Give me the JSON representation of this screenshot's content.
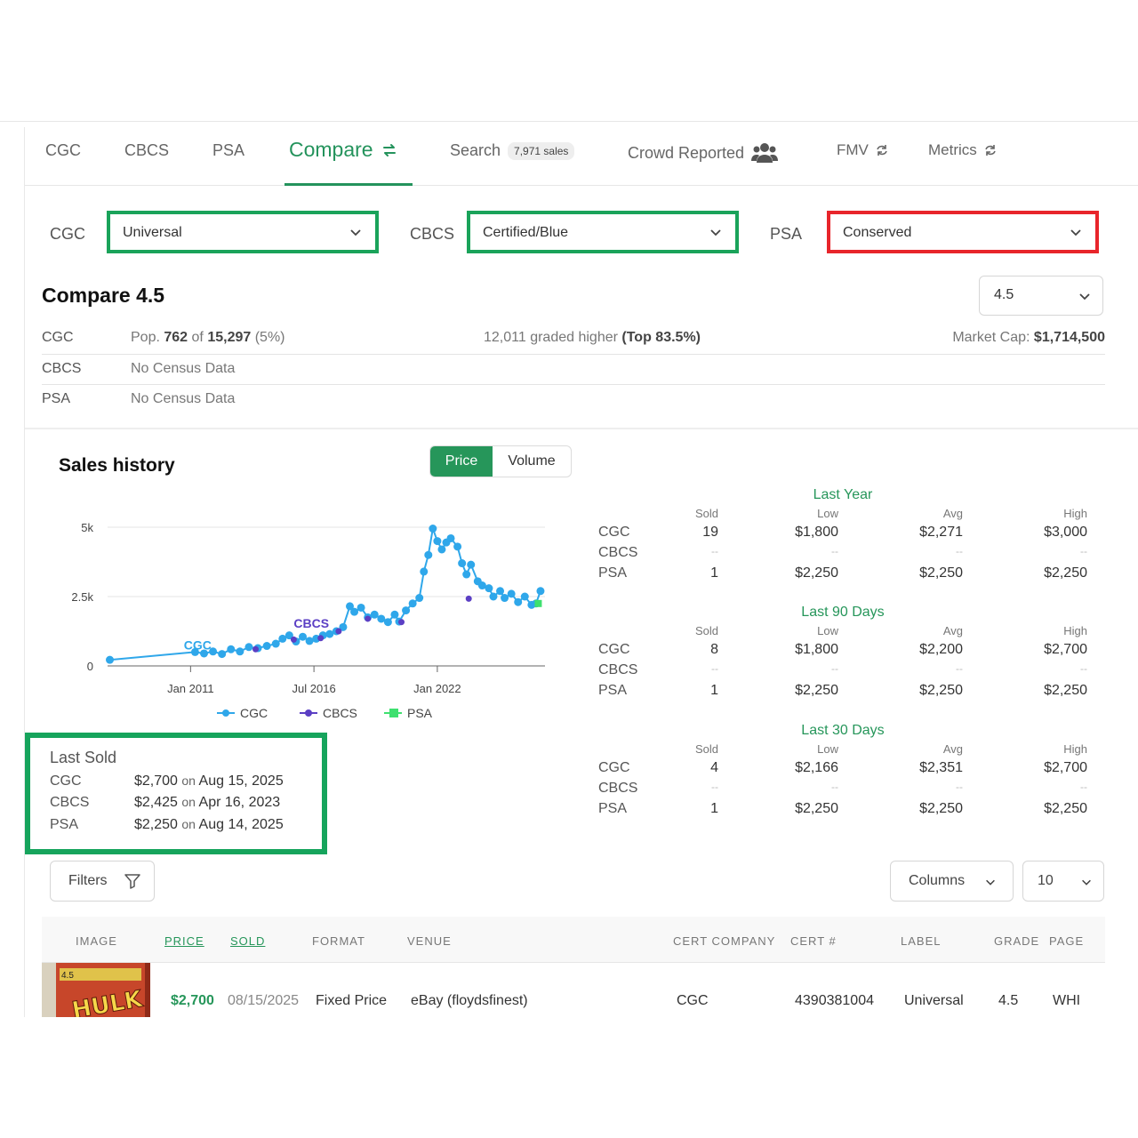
{
  "tabs": [
    {
      "label": "CGC"
    },
    {
      "label": "CBCS"
    },
    {
      "label": "PSA"
    },
    {
      "label": "Compare"
    },
    {
      "label": "Search",
      "badge": "7,971 sales"
    },
    {
      "label": "Crowd Reported"
    },
    {
      "label": "FMV"
    },
    {
      "label": "Metrics"
    }
  ],
  "filters": {
    "cgc_label": "CGC",
    "cgc_value": "Universal",
    "cbcs_label": "CBCS",
    "cbcs_value": "Certified/Blue",
    "psa_label": "PSA",
    "psa_value": "Conserved"
  },
  "compare": {
    "title": "Compare 4.5",
    "grade": "4.5",
    "rows": [
      {
        "company": "CGC",
        "pop_prefix": "Pop.",
        "pop_count": "762",
        "pop_of": "of",
        "pop_total": "15,297",
        "pop_pct": "(5%)",
        "higher": "12,011 graded higher",
        "higher_top": "(Top 83.5%)",
        "mcap_label": "Market Cap:",
        "mcap": "$1,714,500"
      },
      {
        "company": "CBCS",
        "census": "No Census Data"
      },
      {
        "company": "PSA",
        "census": "No Census Data"
      }
    ]
  },
  "sales_history": {
    "title": "Sales history",
    "toggle_price": "Price",
    "toggle_volume": "Volume"
  },
  "chart_data": {
    "type": "scatter",
    "yticks": [
      "0",
      "2.5k",
      "5k"
    ],
    "ylim": [
      0,
      5000
    ],
    "xticks": [
      "Jan 2011",
      "Jul 2016",
      "Jan 2022"
    ],
    "annotations": [
      "CGC",
      "CBCS"
    ],
    "legend": [
      "CGC",
      "CBCS",
      "PSA"
    ],
    "series": [
      {
        "name": "CGC",
        "color": "#2fa7ea",
        "points": [
          [
            2007.4,
            220
          ],
          [
            2011.2,
            500
          ],
          [
            2011.6,
            450
          ],
          [
            2012.0,
            520
          ],
          [
            2012.4,
            430
          ],
          [
            2012.8,
            600
          ],
          [
            2013.2,
            520
          ],
          [
            2013.6,
            680
          ],
          [
            2014.0,
            640
          ],
          [
            2014.4,
            720
          ],
          [
            2014.8,
            800
          ],
          [
            2015.1,
            980
          ],
          [
            2015.4,
            1100
          ],
          [
            2015.7,
            880
          ],
          [
            2016.0,
            1050
          ],
          [
            2016.3,
            900
          ],
          [
            2016.6,
            980
          ],
          [
            2016.9,
            1100
          ],
          [
            2017.2,
            1150
          ],
          [
            2017.5,
            1250
          ],
          [
            2017.8,
            1400
          ],
          [
            2018.1,
            2150
          ],
          [
            2018.3,
            1950
          ],
          [
            2018.6,
            2100
          ],
          [
            2018.9,
            1750
          ],
          [
            2019.2,
            1850
          ],
          [
            2019.5,
            1700
          ],
          [
            2019.8,
            1580
          ],
          [
            2020.1,
            1850
          ],
          [
            2020.3,
            1600
          ],
          [
            2020.6,
            2000
          ],
          [
            2020.9,
            2250
          ],
          [
            2021.2,
            2450
          ],
          [
            2021.4,
            3400
          ],
          [
            2021.6,
            4000
          ],
          [
            2021.8,
            4950
          ],
          [
            2022.0,
            4500
          ],
          [
            2022.2,
            4200
          ],
          [
            2022.4,
            4450
          ],
          [
            2022.6,
            4600
          ],
          [
            2022.9,
            4300
          ],
          [
            2023.1,
            3700
          ],
          [
            2023.3,
            3300
          ],
          [
            2023.5,
            3650
          ],
          [
            2023.8,
            3050
          ],
          [
            2024.0,
            2900
          ],
          [
            2024.3,
            2800
          ],
          [
            2024.5,
            2500
          ],
          [
            2024.8,
            2700
          ],
          [
            2025.0,
            2450
          ],
          [
            2025.3,
            2600
          ],
          [
            2025.6,
            2300
          ],
          [
            2025.9,
            2500
          ],
          [
            2026.2,
            2200
          ],
          [
            2026.4,
            2250
          ],
          [
            2026.6,
            2700
          ]
        ]
      },
      {
        "name": "CBCS",
        "color": "#5b3fc4",
        "points": [
          [
            2013.9,
            600
          ],
          [
            2015.6,
            950
          ],
          [
            2016.8,
            1000
          ],
          [
            2017.6,
            1250
          ],
          [
            2018.9,
            1700
          ],
          [
            2020.4,
            1580
          ],
          [
            2023.4,
            2425
          ]
        ]
      },
      {
        "name": "PSA",
        "color": "#3ee06f",
        "points": [
          [
            2026.5,
            2250
          ]
        ]
      }
    ]
  },
  "last_sold": {
    "title": "Last Sold",
    "rows": [
      {
        "company": "CGC",
        "price": "$2,700",
        "on": "on",
        "date": "Aug 15, 2025"
      },
      {
        "company": "CBCS",
        "price": "$2,425",
        "on": "on",
        "date": "Apr 16, 2023"
      },
      {
        "company": "PSA",
        "price": "$2,250",
        "on": "on",
        "date": "Aug 14, 2025"
      }
    ]
  },
  "stats": {
    "headers": {
      "sold": "Sold",
      "low": "Low",
      "avg": "Avg",
      "high": "High"
    },
    "blocks": [
      {
        "title": "Last Year",
        "rows": [
          {
            "company": "CGC",
            "sold": "19",
            "low": "$1,800",
            "avg": "$2,271",
            "high": "$3,000"
          },
          {
            "company": "CBCS",
            "sold": "--",
            "low": "--",
            "avg": "--",
            "high": "--"
          },
          {
            "company": "PSA",
            "sold": "1",
            "low": "$2,250",
            "avg": "$2,250",
            "high": "$2,250"
          }
        ]
      },
      {
        "title": "Last 90 Days",
        "rows": [
          {
            "company": "CGC",
            "sold": "8",
            "low": "$1,800",
            "avg": "$2,200",
            "high": "$2,700"
          },
          {
            "company": "CBCS",
            "sold": "--",
            "low": "--",
            "avg": "--",
            "high": "--"
          },
          {
            "company": "PSA",
            "sold": "1",
            "low": "$2,250",
            "avg": "$2,250",
            "high": "$2,250"
          }
        ]
      },
      {
        "title": "Last 30 Days",
        "rows": [
          {
            "company": "CGC",
            "sold": "4",
            "low": "$2,166",
            "avg": "$2,351",
            "high": "$2,700"
          },
          {
            "company": "CBCS",
            "sold": "--",
            "low": "--",
            "avg": "--",
            "high": "--"
          },
          {
            "company": "PSA",
            "sold": "1",
            "low": "$2,250",
            "avg": "$2,250",
            "high": "$2,250"
          }
        ]
      }
    ]
  },
  "table_controls": {
    "filters": "Filters",
    "columns": "Columns",
    "page_size": "10"
  },
  "table": {
    "headers": [
      "IMAGE",
      "PRICE",
      "SOLD",
      "FORMAT",
      "VENUE",
      "CERT COMPANY",
      "CERT #",
      "LABEL",
      "GRADE",
      "PAGE"
    ],
    "rows": [
      {
        "image_text": "HULK",
        "image_grade": "4.5",
        "price": "$2,700",
        "sold": "08/15/2025",
        "format": "Fixed Price",
        "venue": "eBay (floydsfinest)",
        "cert_company": "CGC",
        "cert_no": "4390381004",
        "label": "Universal",
        "grade": "4.5",
        "page": "WHI"
      }
    ]
  },
  "colors": {
    "accent": "#26965a",
    "highlight_green": "#16a45c",
    "highlight_red": "#e8252b"
  }
}
